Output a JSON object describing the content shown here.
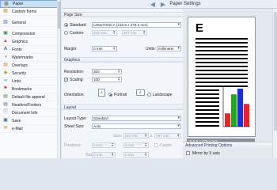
{
  "header": {
    "title": "Paper Settings",
    "back_icon": "arrow-left",
    "forward_icon": "arrow-right"
  },
  "sidebar": {
    "items": [
      {
        "label": "Paper",
        "icon": "paper-icon",
        "selected": true
      },
      {
        "label": "Custom forms",
        "icon": "forms-icon"
      },
      {
        "label": "General",
        "icon": "general-icon"
      },
      {
        "label": "Compression",
        "icon": "compression-icon"
      },
      {
        "label": "Graphics",
        "icon": "graphics-icon"
      },
      {
        "label": "Fonts",
        "icon": "fonts-icon"
      },
      {
        "label": "Watermarks",
        "icon": "watermark-icon"
      },
      {
        "label": "Overlays",
        "icon": "overlay-icon"
      },
      {
        "label": "Security",
        "icon": "security-icon"
      },
      {
        "label": "Links",
        "icon": "links-icon"
      },
      {
        "label": "Bookmarks",
        "icon": "bookmark-icon"
      },
      {
        "label": "Default file append",
        "icon": "append-icon"
      },
      {
        "label": "Headers/Footers",
        "icon": "header-footer-icon"
      },
      {
        "label": "Document Info",
        "icon": "info-icon"
      },
      {
        "label": "Save",
        "icon": "save-icon"
      },
      {
        "label": "e-Mail",
        "icon": "email-icon"
      }
    ]
  },
  "paper_size": {
    "section_title": "Page Size",
    "standard_label": "Standard:",
    "standard_value": "Letter/ANSI A (215.9 x 279.4 mm)",
    "custom_label": "Custom:",
    "custom_width": "215 mm",
    "custom_height": "297 mm",
    "margin_label": "Margin:",
    "margin_value": "0 mm",
    "units_label": "Units:",
    "units_value": "millimeter"
  },
  "graphics": {
    "section_title": "Graphics",
    "resolution_label": "Resolution:",
    "resolution_value": "300",
    "scaling_label": "Scaling:",
    "scaling_value": "100",
    "orientation_label": "Orientation:",
    "portrait_label": "Portrait",
    "landscape_label": "Landscape"
  },
  "layout": {
    "section_title": "Layout",
    "layout_type_label": "Layout Type:",
    "layout_type_value": "Standard",
    "sheet_size_label": "Sheet Size:",
    "sheet_size_value": "Auto",
    "size_label": "Size:",
    "size_width": "210 mm",
    "size_height": "297 mm",
    "positions_label": "Positions:",
    "positions_x": "0 mm",
    "positions_y": "0 mm",
    "center_label": "Center",
    "size_label_2": "Size:",
    "size2_width": "0 mm",
    "size2_height": "0 mm"
  },
  "preview": {
    "letter": "E",
    "paper_label": "215.9 x 279.4 mm",
    "advanced_title": "Advanced Printing Options",
    "mirror_label": "Mirror by X axis",
    "bar_colors": [
      "#e8262a",
      "#26a51f",
      "#1f2fd6",
      "#e8262a"
    ],
    "bar_heights_fraction": [
      0.35,
      0.85,
      1.0,
      0.6
    ]
  }
}
